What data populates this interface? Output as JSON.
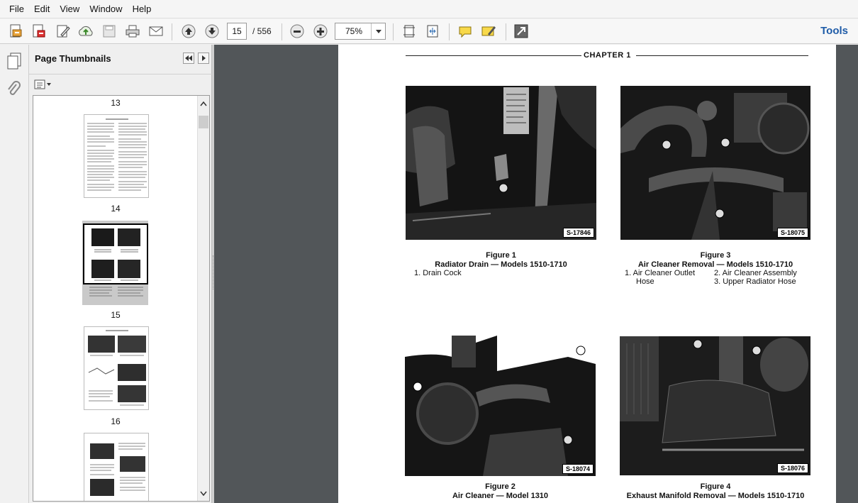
{
  "menu": [
    "File",
    "Edit",
    "View",
    "Window",
    "Help"
  ],
  "toolbar": {
    "current_page": "15",
    "total_pages": "/ 556",
    "zoom": "75%",
    "tools_label": "Tools",
    "icons": [
      "create-pdf-icon",
      "convert-icon",
      "edit-icon",
      "cloud-upload-icon",
      "save-icon",
      "print-icon",
      "email-icon",
      "page-up-icon",
      "page-down-icon",
      "zoom-out-icon",
      "zoom-in-icon",
      "fit-page-icon",
      "fit-width-icon",
      "comment-icon",
      "highlight-icon",
      "fullscreen-icon"
    ]
  },
  "sidebar": {
    "title": "Page Thumbnails",
    "page_numbers": [
      "13",
      "14",
      "15",
      "16"
    ],
    "selected_page": "15"
  },
  "document": {
    "chapter": "CHAPTER 1",
    "figures": [
      {
        "number": "Figure 1",
        "title": "Radiator Drain — Models 1510-1710",
        "code": "S-17846",
        "items": [
          "1.  Drain Cock"
        ]
      },
      {
        "number": "Figure 3",
        "title": "Air Cleaner Removal — Models 1510-1710",
        "code": "S-18075",
        "items": [
          "1.  Air Cleaner Outlet",
          "Hose",
          "2.  Air Cleaner  Assembly",
          "3.  Upper Radiator Hose"
        ]
      },
      {
        "number": "Figure 2",
        "title": "Air Cleaner — Model 1310",
        "code": "S-18074",
        "items": []
      },
      {
        "number": "Figure 4",
        "title": "Exhaust Manifold Removal — Models 1510-1710",
        "code": "S-18076",
        "items": []
      }
    ]
  },
  "colors": {
    "viewer_bg": "#525659",
    "tools_blue": "#1f5ca8",
    "panel_bg": "#efefef"
  }
}
